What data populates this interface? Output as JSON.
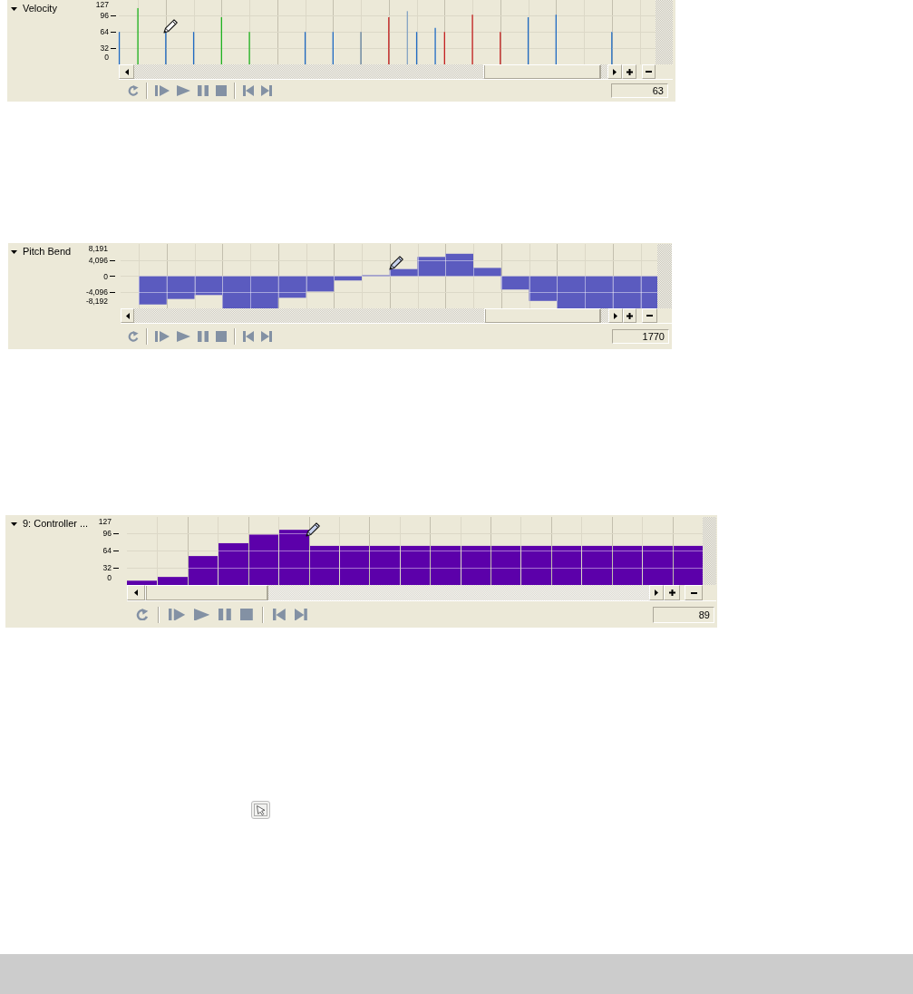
{
  "lanes": [
    {
      "kind": "velocity",
      "title": "Velocity",
      "expanded": true,
      "chart_data": {
        "type": "bar",
        "categories": [
          null,
          null,
          null,
          null,
          null,
          null,
          null,
          null,
          null,
          null,
          null,
          null,
          null,
          null,
          null,
          null,
          null,
          null,
          null,
          null,
          null,
          null,
          null,
          null,
          null,
          null,
          null,
          null,
          null,
          null,
          null,
          null,
          null,
          null,
          null,
          null,
          null,
          null,
          null,
          null,
          null,
          null,
          null,
          null,
          null,
          null,
          null,
          null,
          null,
          null,
          null,
          null,
          null,
          null,
          null,
          null,
          null,
          null
        ],
        "series": [
          {
            "color": "#1f6bc4",
            "values": [
              64,
              null,
              null,
              null,
              null,
              64,
              null,
              null,
              64,
              null,
              null,
              null,
              null,
              null,
              null,
              null,
              null,
              null,
              null,
              null,
              64,
              null,
              null,
              64,
              null,
              null,
              null,
              null,
              null,
              null,
              null,
              null,
              64,
              null,
              72,
              null,
              null,
              null,
              null,
              null,
              null,
              null,
              null,
              null,
              93,
              null,
              null,
              98,
              null,
              null,
              null,
              null,
              null,
              64,
              null,
              null,
              null,
              null
            ]
          },
          {
            "color": "#1fb21f",
            "values": [
              null,
              null,
              111,
              null,
              null,
              null,
              null,
              null,
              null,
              null,
              null,
              93,
              null,
              null,
              64,
              null,
              null,
              null,
              null,
              null,
              null,
              null,
              null,
              null,
              null,
              null,
              null,
              null,
              null,
              null,
              null,
              null,
              null,
              null,
              null,
              null,
              null,
              null,
              null,
              null,
              null,
              null,
              null,
              null,
              null,
              null,
              null,
              null,
              null,
              null,
              null,
              null,
              null,
              null,
              null,
              null,
              null,
              null
            ]
          },
          {
            "color": "#5f7e9e",
            "values": [
              null,
              null,
              null,
              null,
              null,
              null,
              null,
              null,
              null,
              null,
              null,
              null,
              null,
              null,
              null,
              null,
              null,
              null,
              null,
              null,
              null,
              null,
              null,
              null,
              null,
              null,
              64,
              null,
              null,
              null,
              null,
              null,
              null,
              null,
              null,
              null,
              null,
              null,
              null,
              null,
              null,
              null,
              null,
              null,
              null,
              null,
              null,
              null,
              null,
              null,
              null,
              null,
              null,
              null,
              null,
              null,
              null,
              null
            ]
          },
          {
            "color": "#c41f1f",
            "values": [
              null,
              null,
              null,
              null,
              null,
              null,
              null,
              null,
              null,
              null,
              null,
              null,
              null,
              null,
              null,
              null,
              null,
              null,
              null,
              null,
              null,
              null,
              null,
              null,
              null,
              null,
              null,
              null,
              null,
              93,
              null,
              null,
              null,
              null,
              null,
              64,
              null,
              null,
              98,
              null,
              null,
              64,
              null,
              null,
              null,
              null,
              null,
              null,
              null,
              null,
              null,
              null,
              null,
              null,
              null,
              null,
              null,
              null
            ]
          },
          {
            "color": "#86a4c4",
            "values": [
              null,
              null,
              null,
              null,
              null,
              null,
              null,
              null,
              null,
              null,
              null,
              null,
              null,
              null,
              null,
              null,
              null,
              null,
              null,
              null,
              null,
              null,
              null,
              null,
              null,
              null,
              null,
              null,
              null,
              null,
              null,
              105,
              null,
              null,
              null,
              null,
              null,
              null,
              null,
              null,
              null,
              null,
              null,
              null,
              null,
              null,
              null,
              null,
              null,
              null,
              null,
              null,
              null,
              null,
              null,
              null,
              null,
              null
            ]
          }
        ],
        "ylim": [
          0,
          127
        ],
        "yticks": [
          0,
          32,
          64,
          96,
          127
        ],
        "grid": true
      },
      "readout": "63"
    },
    {
      "kind": "pitch_bend",
      "title": "Pitch Bend",
      "expanded": true,
      "chart_data": {
        "type": "bar",
        "categories": [
          null,
          null,
          null,
          null,
          null,
          null,
          null,
          null,
          null,
          null,
          null,
          null,
          null,
          null,
          null,
          null,
          null,
          null,
          null,
          null
        ],
        "series": [
          {
            "color": "#5b5bbf",
            "values": [
              null,
              -7200,
              -5800,
              -4800,
              -8192,
              -8192,
              -5500,
              -3900,
              -1100,
              200,
              1800,
              4900,
              5700,
              2100,
              -3400,
              -6300,
              -8192,
              -8192,
              -8192,
              -8192
            ]
          }
        ],
        "ylim": [
          -8192,
          8191
        ],
        "yticks": [
          {
            "value": 8191,
            "label": "8,191"
          },
          {
            "value": 4096,
            "label": "4,096"
          },
          0,
          {
            "value": -4096,
            "label": "-4,096"
          },
          {
            "value": -8192,
            "label": "-8,192"
          }
        ],
        "grid": true
      },
      "readout": "1770"
    },
    {
      "kind": "controller",
      "title": "9: Controller ...",
      "expanded": true,
      "chart_data": {
        "type": "bar",
        "categories": [
          null,
          null,
          null,
          null,
          null,
          null,
          null,
          null,
          null,
          null,
          null,
          null,
          null,
          null,
          null,
          null,
          null,
          null,
          null
        ],
        "series": [
          {
            "color": "#5c00aa",
            "values": [
              8,
              15,
              54,
              78,
              94,
              103,
              73,
              73,
              73,
              73,
              73,
              73,
              73,
              73,
              73,
              73,
              73,
              73,
              73
            ]
          }
        ],
        "ylim": [
          0,
          127
        ],
        "yticks": [
          0,
          32,
          64,
          96,
          127
        ],
        "grid": true
      },
      "readout": "89"
    }
  ]
}
